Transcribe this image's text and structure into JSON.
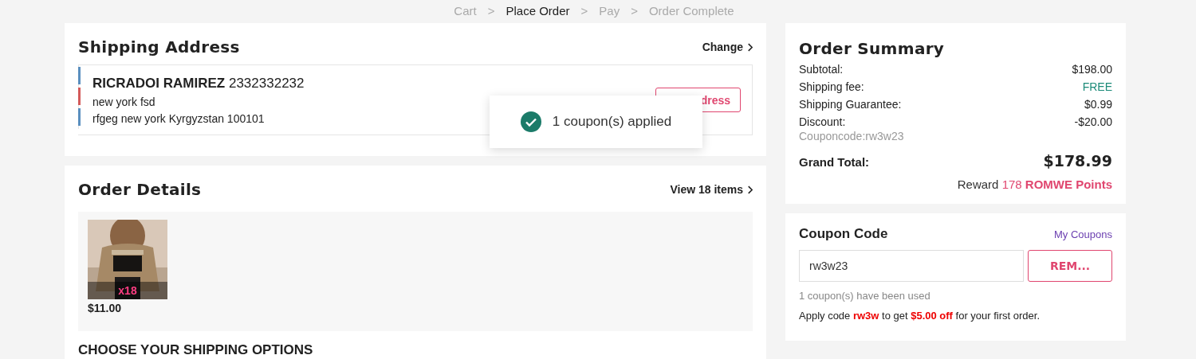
{
  "breadcrumb": [
    {
      "label": "Cart",
      "selected": false
    },
    {
      "label": "Place Order",
      "selected": true
    },
    {
      "label": "Pay",
      "selected": false
    },
    {
      "label": "Order Complete",
      "selected": false
    }
  ],
  "separator": ">",
  "shipping_address": {
    "title": "Shipping Address",
    "change_link": "Change",
    "name": "RICRADOI RAMIREZ",
    "phone": "2332332232",
    "line_1": "new york fsd",
    "line_2": "rfgeg new york Kyrgyzstan 100101",
    "edit_button": "dress"
  },
  "toast": {
    "message": "1 coupon(s) applied"
  },
  "order_details": {
    "title": "Order Details",
    "view_link": "View 18 items",
    "items": [
      {
        "kind": "picture",
        "quantity": "x18",
        "price": "$11.00"
      }
    ],
    "shipping_heading": "CHOOSE YOUR SHIPPING OPTIONS"
  },
  "order_summary": {
    "title": "Order Summary",
    "rows": [
      {
        "label": "Subtotal:",
        "value": "$198.00",
        "kind": "plain"
      },
      {
        "label": "Shipping fee:",
        "value": "FREE",
        "kind": "free"
      },
      {
        "label": "Shipping Guarantee:",
        "value": "$0.99",
        "kind": "plain"
      },
      {
        "label": "Discount:",
        "value": "-$20.00",
        "kind": "plain",
        "note": "Couponcode:rw3w23"
      }
    ],
    "grand_total_label": "Grand Total:",
    "grand_total": "$178.99",
    "reward": "Reward",
    "reward_points": "178",
    "reward_unit": "ROMWE Points"
  },
  "coupon": {
    "title": "Coupon Code",
    "my_coupons": "My Coupons",
    "value": "rw3w23",
    "button": "REM...",
    "used_note": "1 coupon(s) have been used",
    "promo": "Apply code **rw3w** to get **$5.00 off** for your first order."
  }
}
